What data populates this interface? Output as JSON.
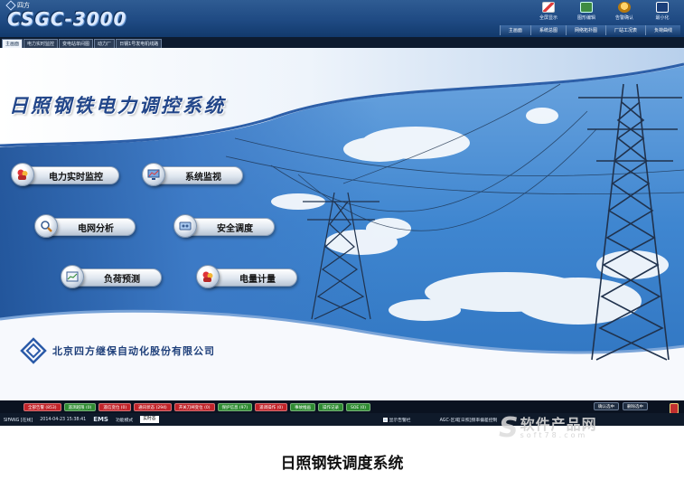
{
  "titlebar": {
    "brand_small": "四方",
    "app_logo": "CSGC-3000",
    "icons": [
      {
        "label": "全屏显示",
        "icon": "fullscreen-icon"
      },
      {
        "label": "图形编辑",
        "icon": "image-edit-icon"
      },
      {
        "label": "告警确认",
        "icon": "alarm-confirm-icon"
      },
      {
        "label": "最小化",
        "icon": "minimize-icon"
      }
    ],
    "nav": [
      "主画面",
      "系统总图",
      "网络拓扑图",
      "厂站工况表",
      "负荷曲线"
    ]
  },
  "tabs": [
    "主画面",
    "电力实时监控",
    "变电站单间图",
    "动力厂",
    "日钢1号发电机线路"
  ],
  "banner": {
    "title": "日照钢铁电力调控系统",
    "menu": [
      {
        "label": "电力实时监控",
        "icon": "power-monitor-icon"
      },
      {
        "label": "系统监视",
        "icon": "system-monitor-icon"
      },
      {
        "label": "电网分析",
        "icon": "grid-analysis-icon"
      },
      {
        "label": "安全调度",
        "icon": "safety-dispatch-icon"
      },
      {
        "label": "负荷预测",
        "icon": "load-forecast-icon"
      },
      {
        "label": "电量计量",
        "icon": "energy-metering-icon"
      }
    ],
    "company": "北京四方继保自动化股份有限公司"
  },
  "alarm_bar": {
    "buttons": [
      {
        "label": "全部告警 (853)",
        "color": "#c1242a"
      },
      {
        "label": "遥测越限 (0)",
        "color": "#2f8b32"
      },
      {
        "label": "遥信变位 (0)",
        "color": "#c1242a"
      },
      {
        "label": "通讯状态 (294)",
        "color": "#c1242a"
      },
      {
        "label": "开关刀闸变位 (0)",
        "color": "#c1242a"
      },
      {
        "label": "保护信息 (97)",
        "color": "#2f8b32"
      },
      {
        "label": "遥调操作 (0)",
        "color": "#c1242a"
      },
      {
        "label": "事故推画",
        "color": "#2f8b32"
      },
      {
        "label": "操作记录",
        "color": "#2f8b32"
      },
      {
        "label": "SOE (0)",
        "color": "#2f8b32"
      }
    ],
    "right_buttons": [
      "确认选中",
      "删除选中"
    ]
  },
  "statusbar": {
    "user": "SIFANG [在线]",
    "datetime": "2014-04-23 15:38:41",
    "ems_label": "EMS",
    "mode_label": "功能模式",
    "mode_value": "实时态",
    "checkbox_label": "显示告警栏",
    "agc_text": "AGC-区域[日照]频率偏差控制"
  },
  "watermark": {
    "letter": "S",
    "cn": "软件产品网",
    "en": "soft78.com"
  },
  "caption": "日照钢铁调度系统"
}
